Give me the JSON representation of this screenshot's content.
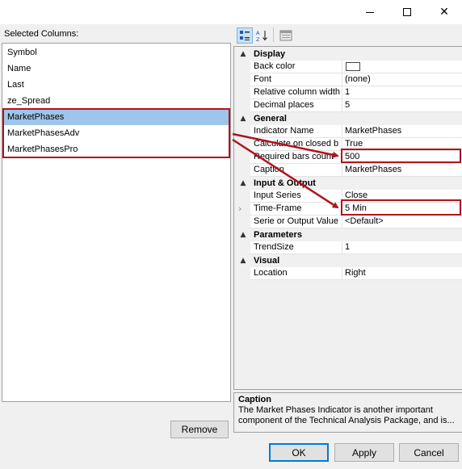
{
  "window": {
    "icons": {
      "minimize": "minimize-icon",
      "maximize": "maximize-icon",
      "close": "close-icon"
    },
    "close_glyph": "✕"
  },
  "left_panel": {
    "label": "Selected Columns:",
    "items": [
      "Symbol",
      "Name",
      "Last",
      "ze_Spread",
      "MarketPhases",
      "MarketPhasesAdv",
      "MarketPhasesPro"
    ],
    "selected_item": "MarketPhases",
    "remove_label": "Remove"
  },
  "toolbar": {
    "categorized_icon": "categorized-icon",
    "alphabetical_icon": "alphabetical-sort-icon",
    "property_pages_icon": "property-pages-icon"
  },
  "properties": {
    "display": {
      "title": "Display",
      "back_color_label": "Back color",
      "back_color_value": "#ffffff",
      "font_label": "Font",
      "font_value": "(none)",
      "relative_width_label": "Relative column width",
      "relative_width_value": "1",
      "decimal_places_label": "Decimal places",
      "decimal_places_value": "5"
    },
    "general": {
      "title": "General",
      "indicator_name_label": "Indicator Name",
      "indicator_name_value": "MarketPhases",
      "calc_closed_label": "Calculate on closed b",
      "calc_closed_value": "True",
      "required_bars_label": "Required bars count",
      "required_bars_value": "500",
      "caption_label": "Caption",
      "caption_value": "MarketPhases"
    },
    "input_output": {
      "title": "Input & Output",
      "input_series_label": "Input Series",
      "input_series_value": "Close",
      "time_frame_label": "Time-Frame",
      "time_frame_value": "5 Min",
      "serie_output_label": "Serie or Output Value",
      "serie_output_value": "<Default>"
    },
    "parameters": {
      "title": "Parameters",
      "trend_size_label": "TrendSize",
      "trend_size_value": "1"
    },
    "visual": {
      "title": "Visual",
      "location_label": "Location",
      "location_value": "Right"
    }
  },
  "description": {
    "title": "Caption",
    "text": "The Market Phases Indicator is another important component of the Technical Analysis Package, and is..."
  },
  "buttons": {
    "ok": "OK",
    "apply": "Apply",
    "cancel": "Cancel"
  },
  "colors": {
    "highlight_red": "#b0141c",
    "selection_blue": "#9fc5ea"
  }
}
